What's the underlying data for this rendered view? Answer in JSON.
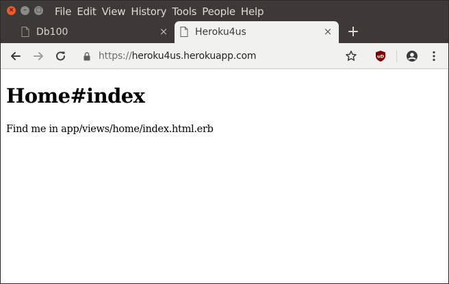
{
  "window": {
    "buttons": {
      "close": "×",
      "minimize": "–",
      "maximize": "□"
    }
  },
  "menu": [
    "File",
    "Edit",
    "View",
    "History",
    "Tools",
    "People",
    "Help"
  ],
  "tabs": [
    {
      "title": "Db100",
      "state": "inactive",
      "icon": "document-icon"
    },
    {
      "title": "Heroku4us",
      "state": "active",
      "icon": "document-icon"
    }
  ],
  "tab_close_glyph": "×",
  "new_tab_glyph": "+",
  "toolbar": {
    "url_scheme": "https://",
    "url_host": "heroku4us.herokuapp.com",
    "icons": [
      "back-icon",
      "forward-icon",
      "reload-icon",
      "lock-icon",
      "star-icon",
      "ublock-icon",
      "profile-icon",
      "menu-icon"
    ],
    "extension_label": "uD"
  },
  "page": {
    "heading": "Home#index",
    "text": "Find me in app/views/home/index.html.erb"
  },
  "colors": {
    "titlebar": "#3b3a36",
    "active_tab": "#f1f1ef",
    "close_button": "#ee5a2d",
    "ublock_red": "#800000"
  }
}
